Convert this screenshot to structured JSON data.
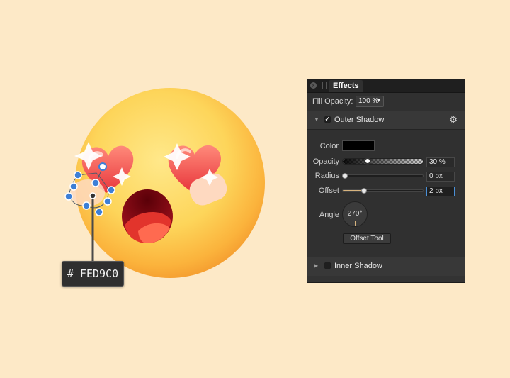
{
  "canvas": {
    "color_tooltip": "# FED9C0",
    "selected_color": "#FED9C0"
  },
  "panel": {
    "tab_label": "Effects",
    "close_glyph": "×",
    "fill_opacity": {
      "label": "Fill Opacity:",
      "value": "100 %",
      "caret": "▼"
    },
    "outer_shadow": {
      "disclosure": "▼",
      "label": "Outer Shadow",
      "checked": true,
      "check_glyph": "✓",
      "gear_icon": "⚙",
      "color_label": "Color",
      "color_value": "#000000",
      "opacity": {
        "label": "Opacity",
        "value": "30 %",
        "fraction": 0.3
      },
      "radius": {
        "label": "Radius",
        "value": "0 px",
        "fraction": 0.0
      },
      "offset": {
        "label": "Offset",
        "value": "2 px",
        "fraction": 0.3
      },
      "angle": {
        "label": "Angle",
        "value": "270°"
      },
      "offset_tool_label": "Offset Tool"
    },
    "inner_shadow": {
      "disclosure": "▶",
      "label": "Inner Shadow",
      "checked": false
    }
  },
  "colors": {
    "background": "#fde9c7",
    "panel": "#303030",
    "accent": "#d8b47e",
    "focus": "#4a8fd6",
    "handle": "#3d7fd6"
  }
}
